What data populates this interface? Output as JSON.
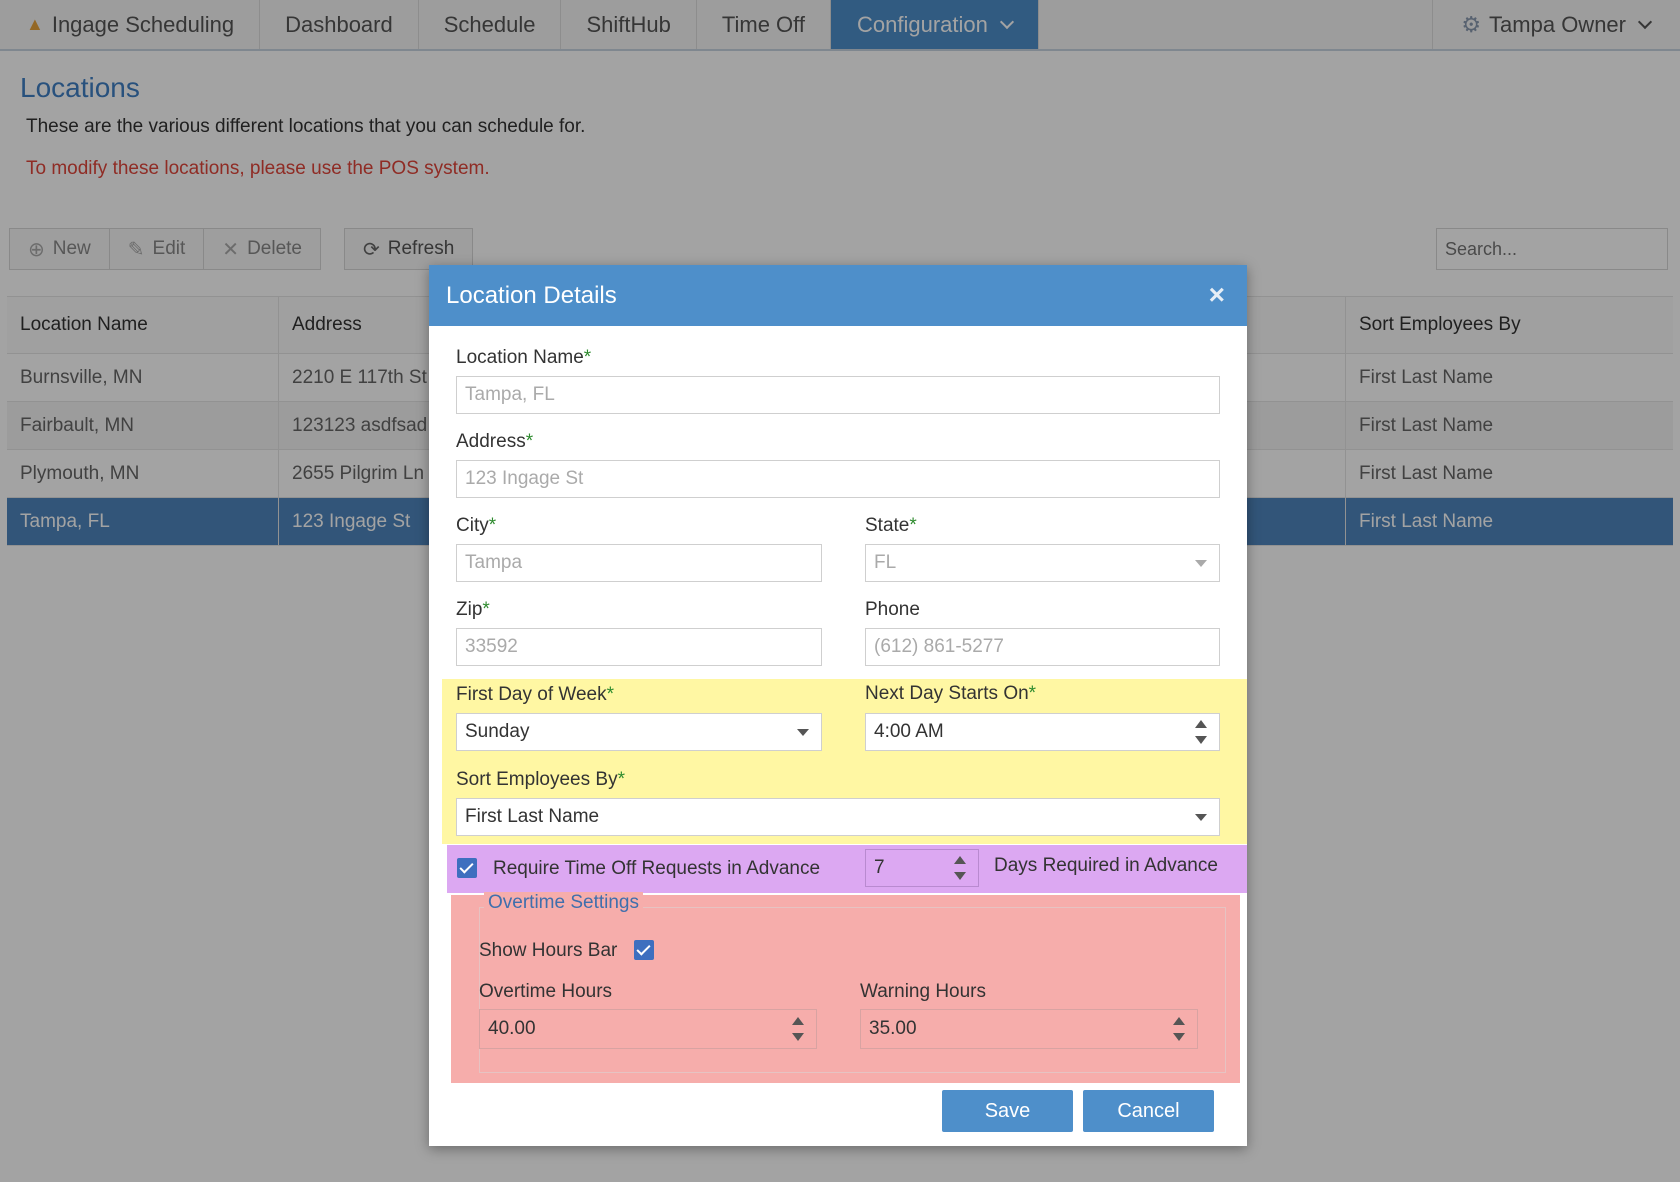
{
  "nav": {
    "brand": "Ingage Scheduling",
    "items": [
      "Dashboard",
      "Schedule",
      "ShiftHub",
      "Time Off"
    ],
    "active": "Configuration",
    "user": "Tampa Owner"
  },
  "page": {
    "title": "Locations",
    "description": "These are the various different locations that you can schedule for.",
    "warning": "To modify these locations, please use the POS system."
  },
  "toolbar": {
    "new": "New",
    "edit": "Edit",
    "delete": "Delete",
    "refresh": "Refresh",
    "search_placeholder": "Search..."
  },
  "grid": {
    "headers": [
      "Location Name",
      "Address",
      "Sort Employees By"
    ],
    "rows": [
      [
        "Burnsville, MN",
        "2210 E 117th St",
        "First Last Name"
      ],
      [
        "Fairbault, MN",
        "123123 asdfsad",
        "First Last Name"
      ],
      [
        "Plymouth, MN",
        "2655 Pilgrim Ln",
        "First Last Name"
      ],
      [
        "Tampa, FL",
        "123 Ingage St",
        "First Last Name"
      ]
    ]
  },
  "modal": {
    "title": "Location Details",
    "close": "×",
    "required_mark": "*",
    "location_name": {
      "label": "Location Name",
      "value": "Tampa, FL"
    },
    "address": {
      "label": "Address",
      "value": "123 Ingage St"
    },
    "city": {
      "label": "City",
      "value": "Tampa"
    },
    "state": {
      "label": "State",
      "value": "FL"
    },
    "zip": {
      "label": "Zip",
      "value": "33592"
    },
    "phone": {
      "label": "Phone",
      "value": "(612) 861-5277"
    },
    "first_day": {
      "label": "First Day of Week",
      "value": "Sunday"
    },
    "next_day": {
      "label": "Next Day Starts On",
      "value": "4:00 AM"
    },
    "sort_by": {
      "label": "Sort Employees By",
      "value": "First Last Name"
    },
    "time_off": {
      "label": "Require Time Off Requests in Advance",
      "days": "7",
      "days_label": "Days Required in Advance"
    },
    "overtime": {
      "legend": "Overtime Settings",
      "show_hours_bar": "Show Hours Bar",
      "overtime_hours": {
        "label": "Overtime Hours",
        "value": "40.00"
      },
      "warning_hours": {
        "label": "Warning Hours",
        "value": "35.00"
      }
    },
    "save": "Save",
    "cancel": "Cancel"
  }
}
